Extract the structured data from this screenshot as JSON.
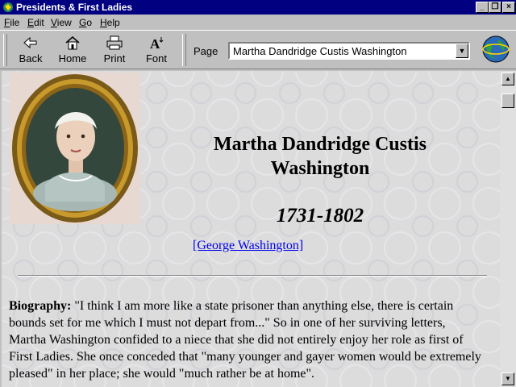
{
  "window": {
    "title": "Presidents & First Ladies",
    "controls": {
      "minimize": "_",
      "maximize": "❐",
      "close": "×"
    }
  },
  "menu": {
    "items": [
      {
        "prefix": "F",
        "rest": "ile"
      },
      {
        "prefix": "E",
        "rest": "dit"
      },
      {
        "prefix": "V",
        "rest": "iew"
      },
      {
        "prefix": "G",
        "rest": "o"
      },
      {
        "prefix": "H",
        "rest": "elp"
      }
    ]
  },
  "toolbar": {
    "back": "Back",
    "home": "Home",
    "print": "Print",
    "font": "Font",
    "page_label": "Page",
    "page_value": "Martha Dandridge Custis Washington"
  },
  "content": {
    "name_line1": "Martha Dandridge Custis",
    "name_line2": "Washington",
    "years": "1731-1802",
    "spouse_link": "[George Washington]",
    "bio_label": "Biography:",
    "bio_text": " \"I think I am more like a state prisoner than anything else, there is certain bounds set for me which I must not depart from...\" So in one of her surviving letters, Martha Washington confided to a niece that she did not entirely enjoy her role as first of First Ladies. She once conceded that \"many younger and gayer women would be extremely pleased\" in her place; she would \"much rather be at home\"."
  },
  "scrollbar": {
    "up": "▲",
    "down": "▼"
  }
}
